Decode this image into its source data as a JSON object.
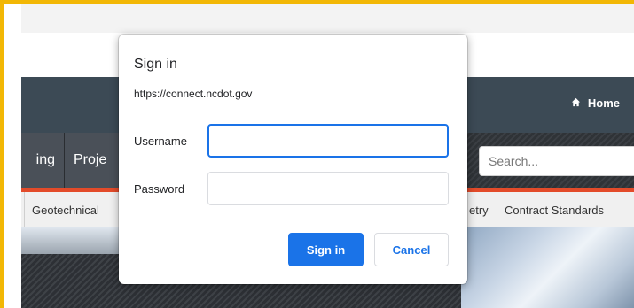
{
  "page": {
    "nav": {
      "home_label": "Home",
      "menu_items": [
        "ing",
        "Proje"
      ],
      "search_placeholder": "Search..."
    },
    "subnav": {
      "items": [
        "Geotechnical",
        "etry",
        "Contract Standards"
      ]
    }
  },
  "dialog": {
    "title": "Sign in",
    "url": "https://connect.ncdot.gov",
    "username_label": "Username",
    "username_value": "",
    "password_label": "Password",
    "password_value": "",
    "signin_label": "Sign in",
    "cancel_label": "Cancel"
  },
  "colors": {
    "accent_blue": "#1a73e8",
    "frame_yellow": "#f2b705",
    "nav_dark": "#3c4a55",
    "accent_red": "#e34b2a"
  },
  "icons": {
    "home": "home-icon"
  }
}
